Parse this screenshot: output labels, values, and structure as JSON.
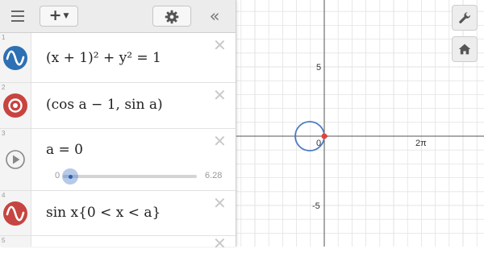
{
  "toolbar": {
    "add_label": "+",
    "collapse_label": "«",
    "menu_icon": "hamburger-menu-icon",
    "settings_icon": "gear-icon"
  },
  "expressions": [
    {
      "number": "1",
      "icon": "sine-wave-icon",
      "color": "#2d70b3",
      "text": "(x + 1)² + y² = 1"
    },
    {
      "number": "2",
      "icon": "point-target-icon",
      "color": "#c74440",
      "text": "(cos a − 1,  sin a)"
    },
    {
      "number": "3",
      "icon": "play-icon",
      "color": "#777777",
      "text": "a = 0",
      "slider": {
        "min": "0",
        "max": "6.28",
        "value": 0
      }
    },
    {
      "number": "4",
      "icon": "sine-wave-icon",
      "color": "#c74440",
      "text": "sin x{0 < x < a}"
    },
    {
      "number": "5"
    }
  ],
  "graph": {
    "tick_labels": {
      "y_pos": "5",
      "y_neg": "-5",
      "x_origin": "0",
      "x_pi": "2π"
    },
    "tools": {
      "wrench": "wrench-icon",
      "home": "home-icon"
    },
    "grid_color": "#e3e3e3",
    "axis_color": "#555555",
    "circle_color": "#4b7cc0",
    "point_color": "#e0443c"
  }
}
